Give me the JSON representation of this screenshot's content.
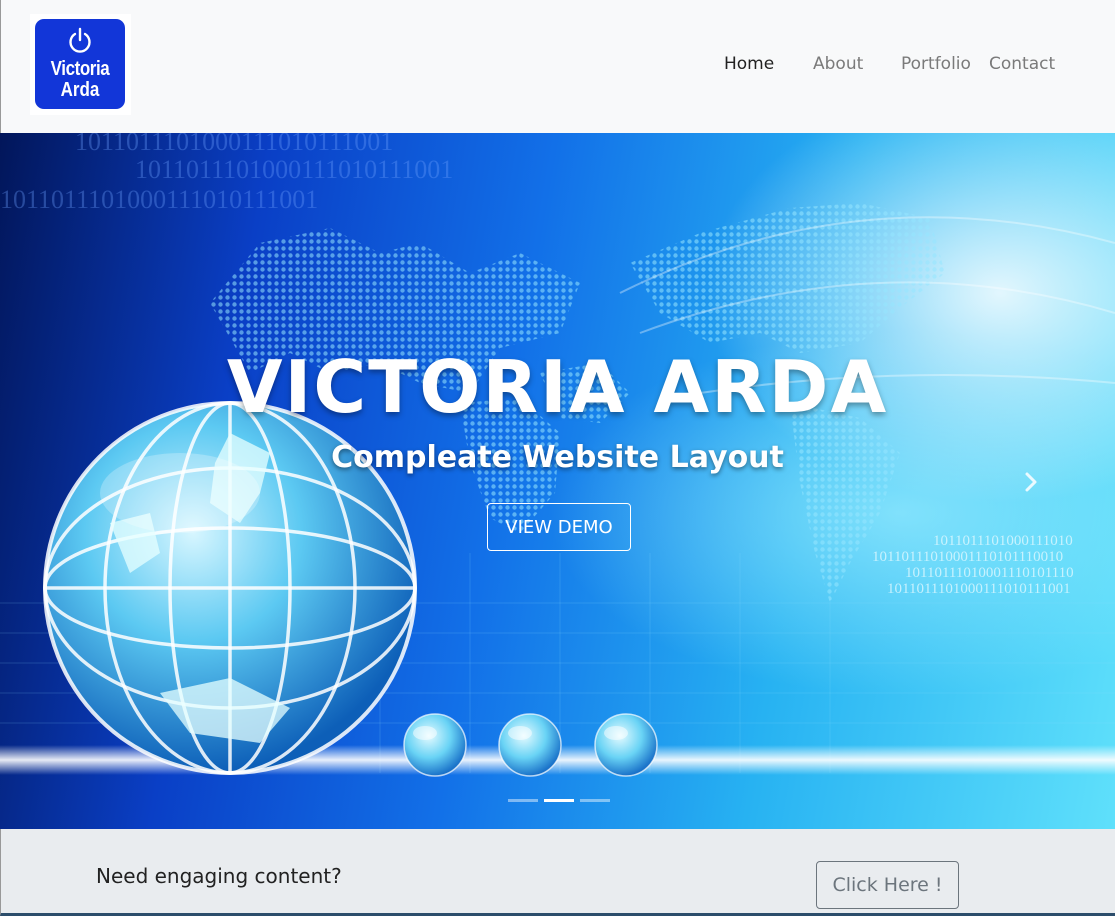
{
  "navbar": {
    "logo": {
      "line1": "Victoria",
      "line2": "Arda",
      "icon": "power-icon",
      "bg_color": "#1236d8"
    },
    "links": [
      {
        "label": "Home",
        "active": true
      },
      {
        "label": "About",
        "active": false
      },
      {
        "label": "Portfolio",
        "active": false
      },
      {
        "label": "Contact",
        "active": false
      }
    ]
  },
  "hero": {
    "title": "VICTORIA ARDA",
    "subtitle": "Compleate Website Layout",
    "button_label": "VIEW DEMO",
    "next_icon": "chevron-right-icon",
    "indicators": {
      "count": 3,
      "active_index": 1
    },
    "binary_text": [
      "1011011101000111010111001",
      "1011011101000111010111001",
      "1011011101000111010111001",
      "1011011101000111010",
      "10110111010001110101110010",
      "10110111010001110101110",
      "1011011101000111010111001"
    ]
  },
  "cta": {
    "text": "Need engaging content?",
    "button_label": "Click Here !"
  }
}
